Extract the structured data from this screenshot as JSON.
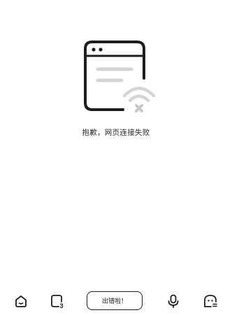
{
  "error": {
    "message": "抱歉，网页连接失败",
    "illustration_icon": "browser-wifi-disconnected-icon"
  },
  "bottom_bar": {
    "home_icon": "home-icon",
    "tabs_icon": "tabs-icon",
    "tabs_count": "3",
    "action_label": "出错啦！",
    "voice_icon": "microphone-icon",
    "profile_icon": "ghost-face-icon"
  },
  "colors": {
    "ink": "#1e1e1e",
    "muted": "#d4d4d4",
    "background": "#ffffff"
  }
}
